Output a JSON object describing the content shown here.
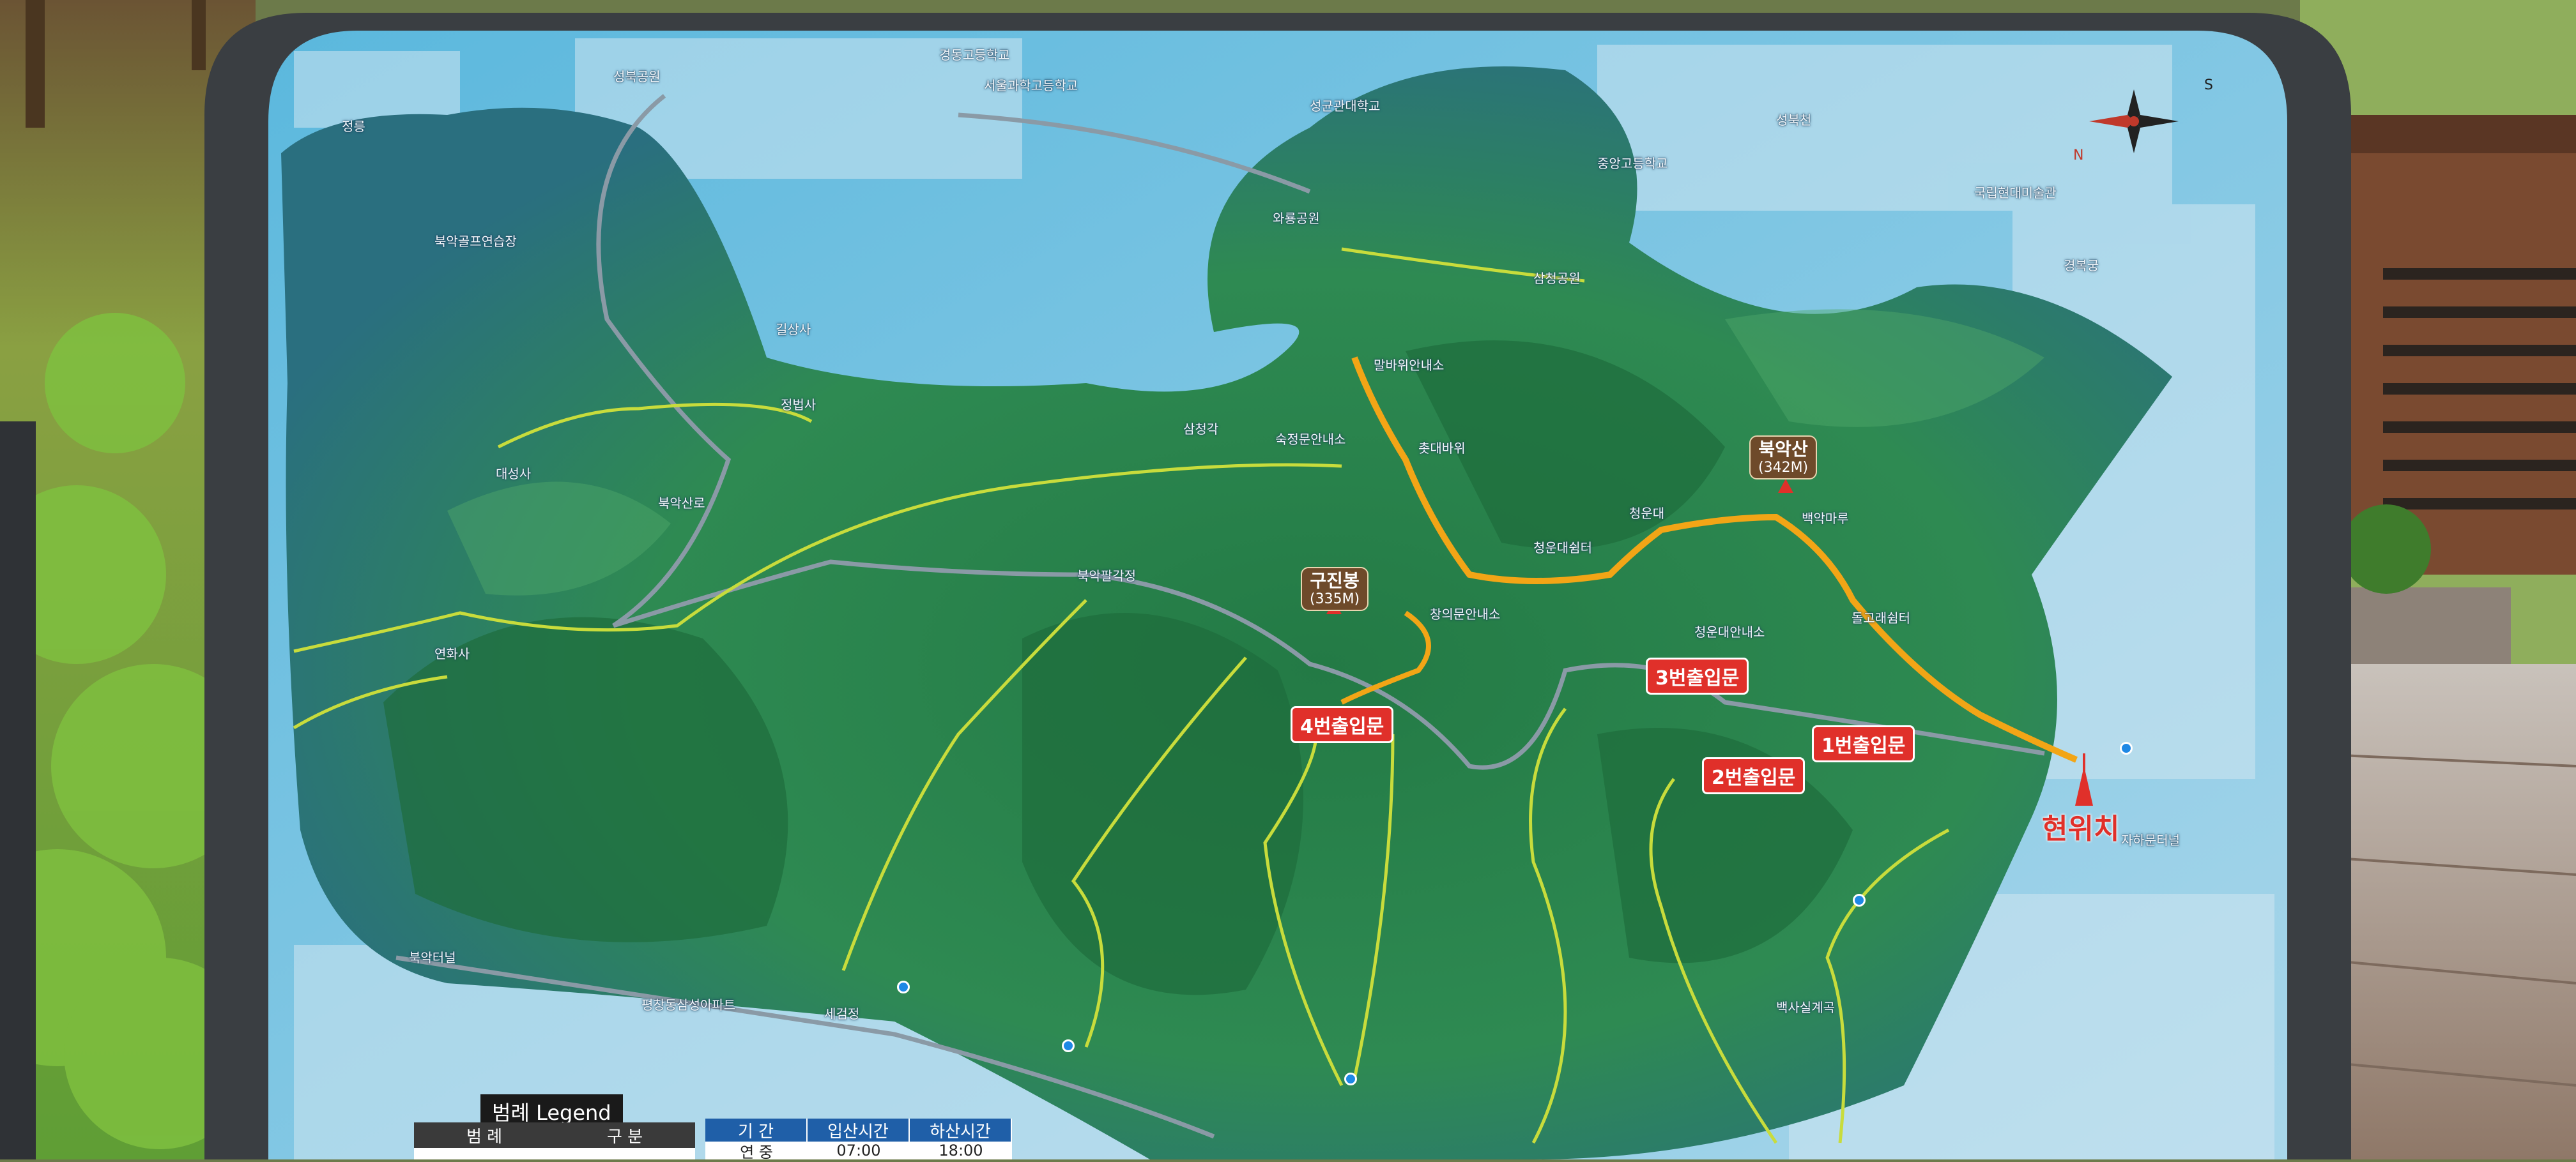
{
  "scene": "Photo of an outdoor trail map sign for Bugaksan mountain",
  "peaks": [
    {
      "name": "북악산",
      "elevation": "(342M)"
    },
    {
      "name": "구진봉",
      "elevation": "(335M)"
    }
  ],
  "entrances": [
    {
      "label": "1번출입문"
    },
    {
      "label": "2번출입문"
    },
    {
      "label": "3번출입문"
    },
    {
      "label": "4번출입문"
    }
  ],
  "you_are_here": "현위치",
  "place_labels": [
    "성북공원",
    "정릉",
    "북악골프연습장",
    "대성사",
    "북악산로",
    "연화사",
    "정법사",
    "길상사",
    "삼청각",
    "숙정문안내소",
    "북악팔각정",
    "와룡공원",
    "말바위안내소",
    "촛대바위",
    "청운대",
    "청운대쉼터",
    "창의문안내소",
    "백악마루",
    "청운대안내소",
    "돌고래쉼터",
    "서울과학고등학교",
    "경동고등학교",
    "성균관대학교",
    "국립현대미술관",
    "북악터널",
    "평창동삼성아파트",
    "백사실계곡",
    "세검정",
    "성북천",
    "삼청공원",
    "중앙고등학교",
    "경복궁",
    "자하문터널"
  ],
  "legend": {
    "title": "범례 Legend",
    "columns": [
      "범 례",
      "구 분"
    ]
  },
  "hours_table": {
    "columns": [
      "기 간",
      "입산시간",
      "하산시간"
    ],
    "first_row": [
      "연 중",
      "07:00",
      "18:00"
    ]
  },
  "colors": {
    "entrance_tag": "#e0302a",
    "trail_yellow": "#c8dc3c",
    "main_trail_orange": "#f2a516",
    "road_gray": "#8a9aa6",
    "board_frame": "#3a3e42",
    "map_water_sky": "#5bb8dd",
    "forest_green": "#2e8a52"
  },
  "icons": [
    "compass-rose-icon",
    "peak-triangle-icon",
    "location-pin-icon"
  ]
}
